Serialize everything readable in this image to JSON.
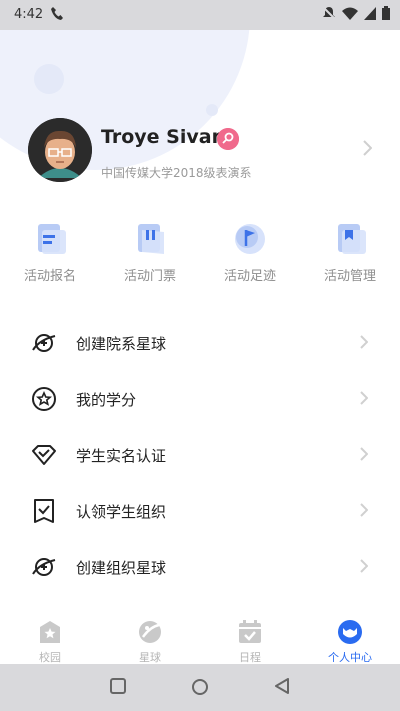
{
  "status_bar": {
    "time": "4:42"
  },
  "profile": {
    "name": "Troye Sivan",
    "subtitle": "中国传媒大学2018级表演系"
  },
  "quick_actions": [
    {
      "label": "活动报名",
      "icon": "registration-icon"
    },
    {
      "label": "活动门票",
      "icon": "ticket-icon"
    },
    {
      "label": "活动足迹",
      "icon": "footprint-icon"
    },
    {
      "label": "活动管理",
      "icon": "management-icon"
    }
  ],
  "menu": [
    {
      "label": "创建院系星球",
      "icon": "planet-add-icon"
    },
    {
      "label": "我的学分",
      "icon": "star-circle-icon"
    },
    {
      "label": "学生实名认证",
      "icon": "diamond-check-icon"
    },
    {
      "label": "认领学生组织",
      "icon": "square-check-icon"
    },
    {
      "label": "创建组织星球",
      "icon": "planet-add-icon"
    }
  ],
  "tabs": [
    {
      "label": "校园",
      "icon": "campus-icon"
    },
    {
      "label": "星球",
      "icon": "planet-icon"
    },
    {
      "label": "日程",
      "icon": "calendar-icon"
    },
    {
      "label": "个人中心",
      "icon": "profile-icon",
      "active": true
    }
  ],
  "colors": {
    "accent": "#2a6bf0",
    "icon_blue": "#b8cbf5",
    "badge": "#f06a8c"
  }
}
